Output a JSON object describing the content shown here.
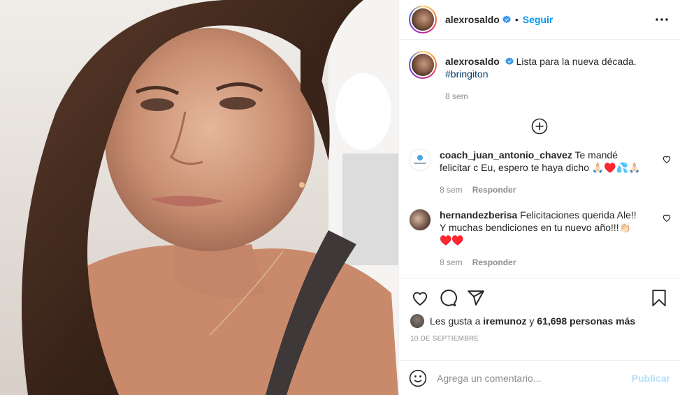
{
  "post": {
    "username": "alexrosaldo",
    "follow_label": "Seguir",
    "dot": "•",
    "caption": "Lista para la nueva década.",
    "hashtag": "#bringiton",
    "caption_time": "8 sem"
  },
  "comments": [
    {
      "username": "coach_juan_antonio_chavez",
      "text": "Te mandé felicitar c Eu, espero te haya dicho 🙏🏻♥️💦🙏🏻",
      "time": "8 sem",
      "reply_label": "Responder"
    },
    {
      "username": "hernandezberisa",
      "text": "Felicitaciones querida Ale!! Y muchas bendiciones en tu nuevo año!!!👏🏻♥️♥️",
      "time": "8 sem",
      "reply_label": "Responder"
    }
  ],
  "likes": {
    "prefix": "Les gusta a",
    "user": "iremunoz",
    "connector": "y",
    "count": "61,698 personas más"
  },
  "date": "10 DE SEPTIEMBRE",
  "comment_box": {
    "placeholder": "Agrega un comentario...",
    "publish_label": "Publicar"
  },
  "colors": {
    "accent": "#0095f6",
    "publish_disabled": "#b2dffc",
    "muted": "#8e8e8e"
  },
  "icons": [
    "verified-icon",
    "more-options-icon",
    "add-comment-circle-icon",
    "heart-icon",
    "comment-icon",
    "share-icon",
    "bookmark-icon",
    "emoji-icon"
  ]
}
